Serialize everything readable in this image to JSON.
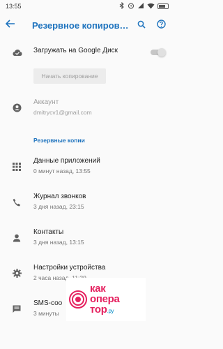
{
  "status": {
    "time": "13:55"
  },
  "appbar": {
    "title": "Резервное копирова..."
  },
  "upload": {
    "label": "Загружать на Google Диск",
    "enabled": false
  },
  "start_button": {
    "label": "Начать копирование"
  },
  "account": {
    "label": "Аккаунт",
    "value": "dmitrycv1@gmail.com"
  },
  "backups": {
    "header": "Резервные копии",
    "items": [
      {
        "title": "Данные приложений",
        "subtitle": "0 минут назад, 13:55",
        "icon": "apps-grid-icon"
      },
      {
        "title": "Журнал звонков",
        "subtitle": "3 дня назад, 23:15",
        "icon": "phone-icon"
      },
      {
        "title": "Контакты",
        "subtitle": "3 дня назад, 13:15",
        "icon": "person-icon"
      },
      {
        "title": "Настройки устройства",
        "subtitle": "2 часа назад, 11:29",
        "icon": "gear-icon"
      },
      {
        "title": "SMS-соо",
        "subtitle": "3 минуты",
        "icon": "message-icon"
      }
    ]
  },
  "watermark": {
    "line1": "как",
    "line2": "опера",
    "line3": "тор",
    "suffix": ".ру"
  },
  "colors": {
    "accent": "#1e73be",
    "watermark_pink": "#e5215f",
    "watermark_blue": "#0a8fc8"
  }
}
